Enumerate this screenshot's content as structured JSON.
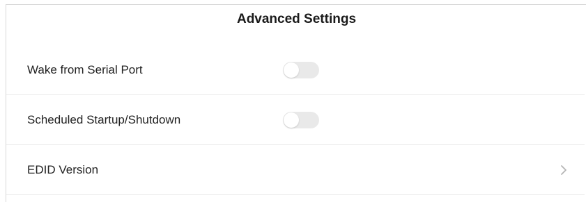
{
  "header": {
    "title": "Advanced Settings"
  },
  "settings": {
    "items": [
      {
        "label": "Wake from Serial Port",
        "control": "toggle",
        "enabled": false
      },
      {
        "label": "Scheduled Startup/Shutdown",
        "control": "toggle",
        "enabled": false
      },
      {
        "label": "EDID Version",
        "control": "chevron-right-icon"
      }
    ]
  },
  "colors": {
    "toggle_off": "#e9e9e9",
    "chevron": "#b5b5b5",
    "divider": "#ececec"
  }
}
